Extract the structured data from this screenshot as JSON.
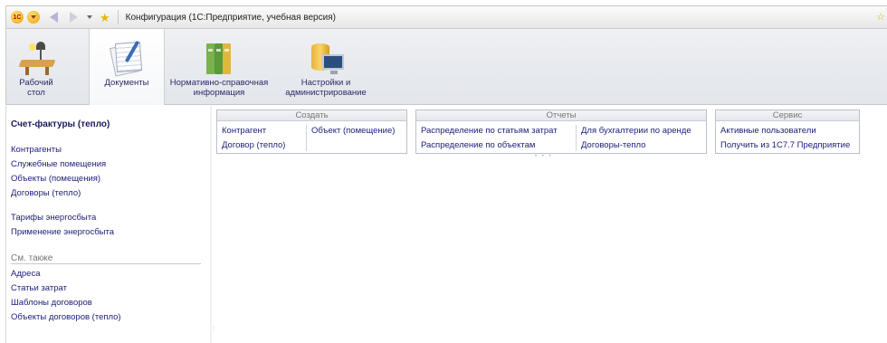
{
  "window": {
    "title": "Конфигурация  (1С:Предприятие, учебная версия)"
  },
  "titlebar_icons": [
    "1c-logo-icon",
    "main-menu-icon",
    "back-arrow-icon",
    "forward-arrow-icon",
    "history-dropdown-icon",
    "favorites-star-icon"
  ],
  "sections": [
    {
      "label": "Рабочий\nстол",
      "icon": "desk-icon"
    },
    {
      "label": "Документы",
      "icon": "documents-icon",
      "active": true
    },
    {
      "label": "Нормативно-справочная\nинформация",
      "icon": "books-icon"
    },
    {
      "label": "Настройки и\nадминистрирование",
      "icon": "settings-icon"
    }
  ],
  "left_panel": {
    "title": "Счет-фактуры (тепло)",
    "items_group1": [
      "Контрагенты",
      "Служебные помещения",
      "Объекты (помещения)",
      "Договоры (тепло)"
    ],
    "items_group2": [
      "Тарифы энергосбыта",
      "Применение энергосбыта"
    ],
    "see_also_label": "См. также",
    "see_also_items": [
      "Адреса",
      "Статьи затрат",
      "Шаблоны договоров",
      "Объекты договоров (тепло)"
    ]
  },
  "groups": {
    "create": {
      "header": "Создать",
      "col1": [
        "Контрагент",
        "Договор (тепло)"
      ],
      "col2": [
        "Объект (помещение)"
      ]
    },
    "reports": {
      "header": "Отчеты",
      "col1": [
        "Распределение по статьям затрат",
        "Распределение по объектам"
      ],
      "col2": [
        "Для бухгалтерии по аренде",
        "Договоры-тепло"
      ]
    },
    "service": {
      "header": "Сервис",
      "col1": [
        "Активные пользователи",
        "Получить из 1С7.7 Предприятие"
      ]
    }
  }
}
